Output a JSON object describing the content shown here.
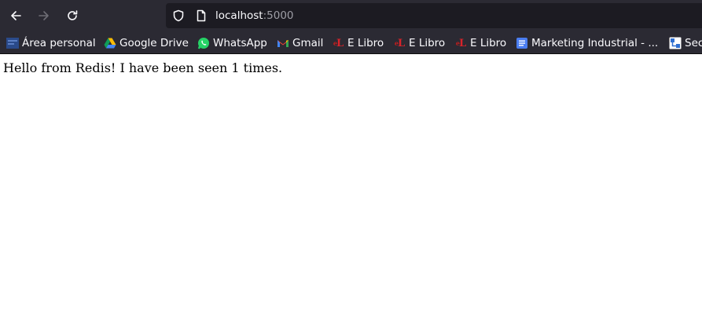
{
  "browser": {
    "url_host": "localhost",
    "url_port": ":5000"
  },
  "bookmarks": [
    {
      "label": "Área personal",
      "icon": "moodle-icon"
    },
    {
      "label": "Google Drive",
      "icon": "google-drive-icon"
    },
    {
      "label": "WhatsApp",
      "icon": "whatsapp-icon"
    },
    {
      "label": "Gmail",
      "icon": "gmail-icon"
    },
    {
      "label": "E Libro",
      "icon": "elibro-icon"
    },
    {
      "label": "E Libro",
      "icon": "elibro-icon"
    },
    {
      "label": "E Libro",
      "icon": "elibro-icon"
    },
    {
      "label": "Marketing Industrial - ...",
      "icon": "google-docs-icon"
    },
    {
      "label": "Sec",
      "icon": "sitemap-icon"
    }
  ],
  "page": {
    "body_text": "Hello from Redis! I have been seen 1 times."
  },
  "colors": {
    "toolbar_bg": "#2b2a33",
    "urlbar_bg": "#1c1b22",
    "text_light": "#fbfbfe",
    "port_gray": "#9e9ea6"
  }
}
